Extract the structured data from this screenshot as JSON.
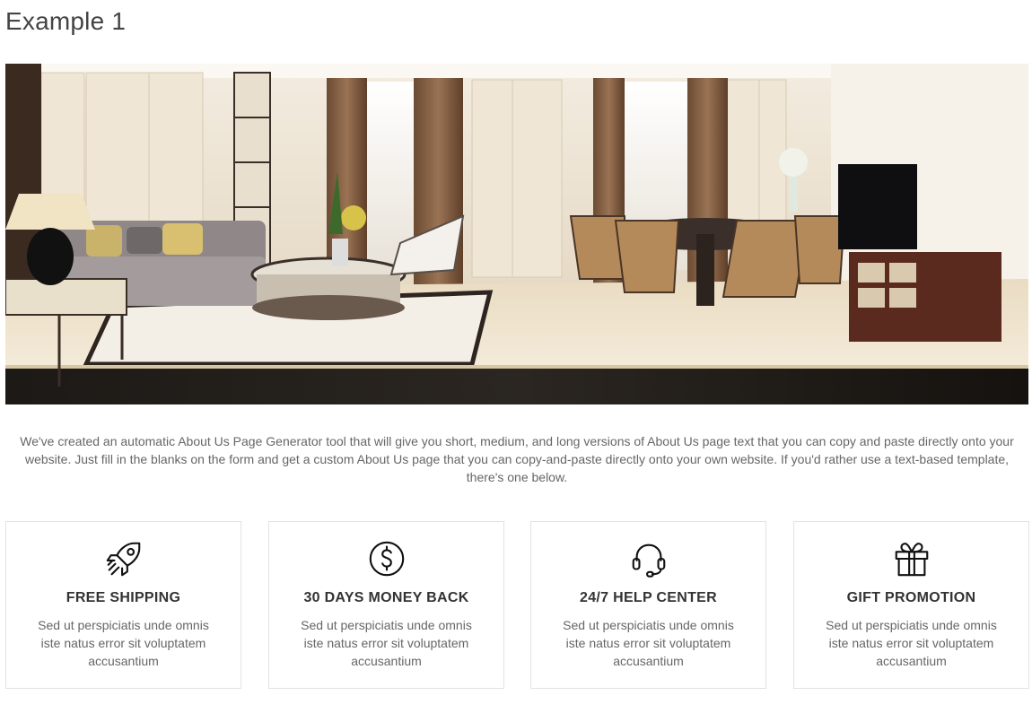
{
  "page": {
    "title": "Example 1"
  },
  "hero": {
    "image_icon": "interior-living-dining-room-photo"
  },
  "intro": {
    "text": "We've created an automatic About Us Page Generator tool that will give you short, medium, and long versions of About Us page text that you can copy and paste directly onto your website. Just fill in the blanks on the form and get a custom About Us page that you can copy-and-paste directly onto your own website. If you'd rather use a text-based template, there's one below."
  },
  "features": [
    {
      "icon": "rocket-icon",
      "title": "FREE SHIPPING",
      "desc": "Sed ut perspiciatis unde omnis iste natus error sit voluptatem accusantium"
    },
    {
      "icon": "dollar-icon",
      "title": "30 DAYS MONEY BACK",
      "desc": "Sed ut perspiciatis unde omnis iste natus error sit voluptatem accusantium"
    },
    {
      "icon": "headset-icon",
      "title": "24/7 HELP CENTER",
      "desc": "Sed ut perspiciatis unde omnis iste natus error sit voluptatem accusantium"
    },
    {
      "icon": "gift-icon",
      "title": "GIFT PROMOTION",
      "desc": "Sed ut perspiciatis unde omnis iste natus error sit voluptatem accusantium"
    }
  ],
  "colors": {
    "text": "#555555",
    "title": "#333333",
    "border": "#e2e2e2"
  }
}
